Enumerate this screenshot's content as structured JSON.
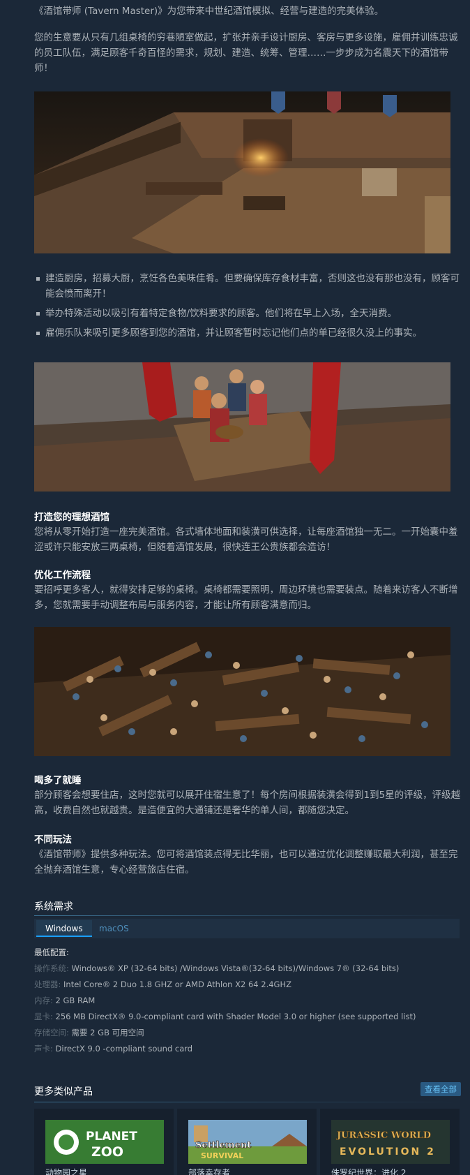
{
  "intro": "《酒馆带师 (Tavern Master)》为您带来中世纪酒馆模拟、经营与建造的完美体验。",
  "description": "您的生意要从只有几组桌椅的穷巷陋室做起，扩张并亲手设计厨房、客房与更多设施，雇佣并训练忠诚的员工队伍，满足顾客千奇百怪的需求，规划、建造、统筹、管理……一步步成为名震天下的酒馆带师！",
  "features": [
    "建造厨房，招募大厨，烹饪各色美味佳肴。但要确保库存食材丰富，否则这也没有那也没有，顾客可能会愤而离开！",
    "举办特殊活动以吸引有着特定食物/饮料要求的顾客。他们将在早上入场，全天消费。",
    "雇佣乐队来吸引更多顾客到您的酒馆，并让顾客暂时忘记他们点的单已经很久没上的事实。"
  ],
  "sections": [
    {
      "title": "打造您的理想酒馆",
      "body": "您将从零开始打造一座完美酒馆。各式墙体地面和装潢可供选择，让每座酒馆独一无二。一开始囊中羞涩或许只能安放三两桌椅，但随着酒馆发展，很快连王公贵族都会造访！"
    },
    {
      "title": "优化工作流程",
      "body": "要招呼更多客人，就得安排足够的桌椅。桌椅都需要照明，周边环境也需要装点。随着来访客人不断增多，您就需要手动调整布局与服务内容，才能让所有顾客满意而归。"
    },
    {
      "title": "喝多了就睡",
      "body": "部分顾客会想要住店，这时您就可以展开住宿生意了！每个房间根据装潢会得到1到5星的评级，评级越高，收费自然也就越贵。是造便宜的大通铺还是奢华的单人间，都随您决定。"
    },
    {
      "title": "不同玩法",
      "body": "《酒馆带师》提供多种玩法。您可将酒馆装点得无比华丽，也可以通过优化调整赚取最大利润，甚至完全抛弃酒馆生意，专心经营旅店住宿。"
    }
  ],
  "sysreq": {
    "title": "系统需求",
    "tabs": [
      "Windows",
      "macOS"
    ],
    "heading": "最低配置:",
    "items": [
      {
        "key": "操作系统:",
        "value": "Windows® XP (32-64 bits) /Windows Vista®(32-64 bits)/Windows 7® (32-64 bits)"
      },
      {
        "key": "处理器:",
        "value": "Intel Core® 2 Duo 1.8 GHZ or AMD Athlon X2 64 2.4GHZ"
      },
      {
        "key": "内存:",
        "value": "2 GB RAM"
      },
      {
        "key": "显卡:",
        "value": "256 MB DirectX® 9.0-compliant card with Shader Model 3.0 or higher (see supported list)"
      },
      {
        "key": "存储空间:",
        "value": "需要 2 GB 可用空间"
      },
      {
        "key": "声卡:",
        "value": "DirectX 9.0 -compliant sound card"
      }
    ]
  },
  "more": {
    "title": "更多类似产品",
    "see_all": "查看全部",
    "cards": [
      {
        "name": "动物园之星",
        "logo_line1": "PLANET",
        "logo_line2": "ZOO"
      },
      {
        "name": "部落幸存者",
        "logo_line1": "Settlement",
        "logo_line2": "SURVIVAL"
      },
      {
        "name": "侏罗纪世界：进化 2",
        "logo_line1": "JURASSIC WORLD",
        "logo_line2": "EVOLUTION 2"
      }
    ]
  },
  "colors": {
    "background": "#1b2838",
    "text": "#acb2b8",
    "link": "#66c0f4",
    "accent": "#1a9fff"
  }
}
